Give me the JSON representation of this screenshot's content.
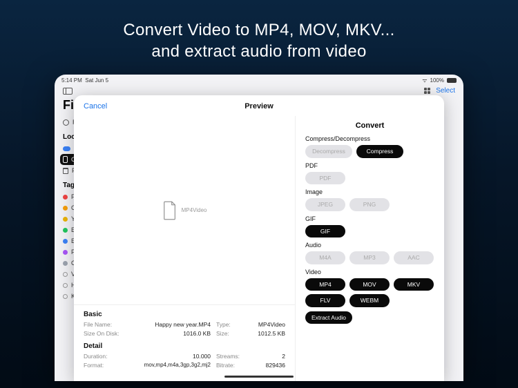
{
  "hero": {
    "line1": "Convert Video to MP4, MOV, MKV...",
    "line2": "and extract audio from video"
  },
  "status": {
    "time": "5:14 PM",
    "date": "Sat Jun 5",
    "battery": "100%"
  },
  "app_bar": {
    "select": "Select"
  },
  "sidebar": {
    "title": "File",
    "recent": "R",
    "locations_label": "Loca",
    "loc_cloud": "i",
    "loc_on": "C",
    "loc_trash": "F",
    "tags_label": "Tags",
    "tags": [
      {
        "color": "#ef4444",
        "t": "F"
      },
      {
        "color": "#f59e0b",
        "t": "C"
      },
      {
        "color": "#eab308",
        "t": "Y"
      },
      {
        "color": "#22c55e",
        "t": "E"
      },
      {
        "color": "#3b82f6",
        "t": "E"
      },
      {
        "color": "#a855f7",
        "t": "F"
      },
      {
        "color": "#9ca3af",
        "t": "C"
      }
    ],
    "extras": [
      "V",
      "H",
      "K"
    ]
  },
  "modal": {
    "cancel": "Cancel",
    "title": "Preview",
    "preview_label": "MP4Video",
    "basic_title": "Basic",
    "basic": {
      "file_name_lbl": "File Name:",
      "file_name": "Happy new year.MP4",
      "type_lbl": "Type:",
      "type": "MP4Video",
      "size_on_disk_lbl": "Size On Disk:",
      "size_on_disk": "1016.0 KB",
      "size_lbl": "Size:",
      "size": "1012.5 KB"
    },
    "detail_title": "Detail",
    "detail": {
      "duration_lbl": "Duration:",
      "duration": "10.000",
      "streams_lbl": "Streams:",
      "streams": "2",
      "format_lbl": "Format:",
      "format": "mov,mp4,m4a,3gp,3g2,mj2",
      "bitrate_lbl": "Bitrate:",
      "bitrate": "829436"
    }
  },
  "convert": {
    "title": "Convert",
    "sections": {
      "compress": "Compress/Decompress",
      "pdf": "PDF",
      "image": "Image",
      "gif": "GIF",
      "audio": "Audio",
      "video": "Video"
    },
    "buttons": {
      "decompress": "Decompress",
      "compress": "Compress",
      "pdf": "PDF",
      "jpeg": "JPEG",
      "png": "PNG",
      "gif": "GIF",
      "m4a": "M4A",
      "mp3": "MP3",
      "aac": "AAC",
      "mp4": "MP4",
      "mov": "MOV",
      "mkv": "MKV",
      "flv": "FLV",
      "webm": "WEBM",
      "extract": "Extract Audio"
    }
  }
}
